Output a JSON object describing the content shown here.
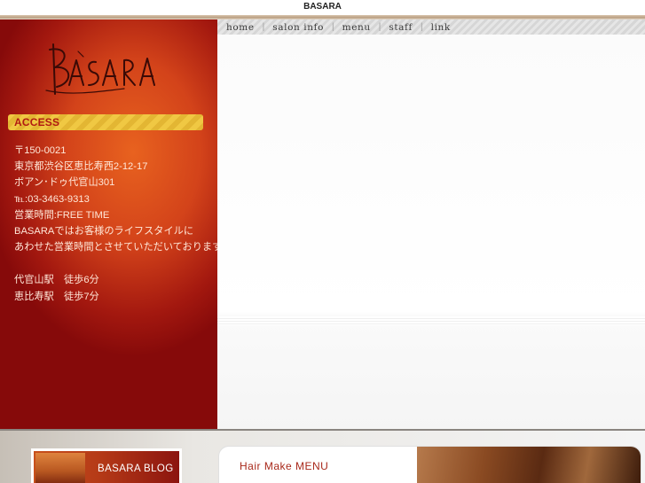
{
  "page": {
    "title": "BASARA"
  },
  "brand": {
    "logo_text": "BASARA"
  },
  "nav": {
    "items": [
      "home",
      "salon info",
      "menu",
      "staff",
      "link"
    ],
    "separator": "|"
  },
  "access": {
    "header": "ACCESS",
    "lines": [
      "〒150-0021",
      "東京都渋谷区恵比寿西2-12-17",
      "ボアン･ドゥ代官山301",
      "℡:03-3463-9313",
      "営業時間:FREE TIME",
      "BASARAではお客様のライフスタイルに",
      "あわせた営業時間とさせていただいております"
    ],
    "stations": [
      "代官山駅　徒歩6分",
      "恵比寿駅　徒歩7分"
    ]
  },
  "banners": {
    "blog": "BASARA BLOG",
    "menu": "Hair Make MENU"
  },
  "colors": {
    "sidebar_center": "#e8621f",
    "sidebar_edge": "#860a0a",
    "access_bar": "#f0c843",
    "menu_label": "#a8281a"
  }
}
